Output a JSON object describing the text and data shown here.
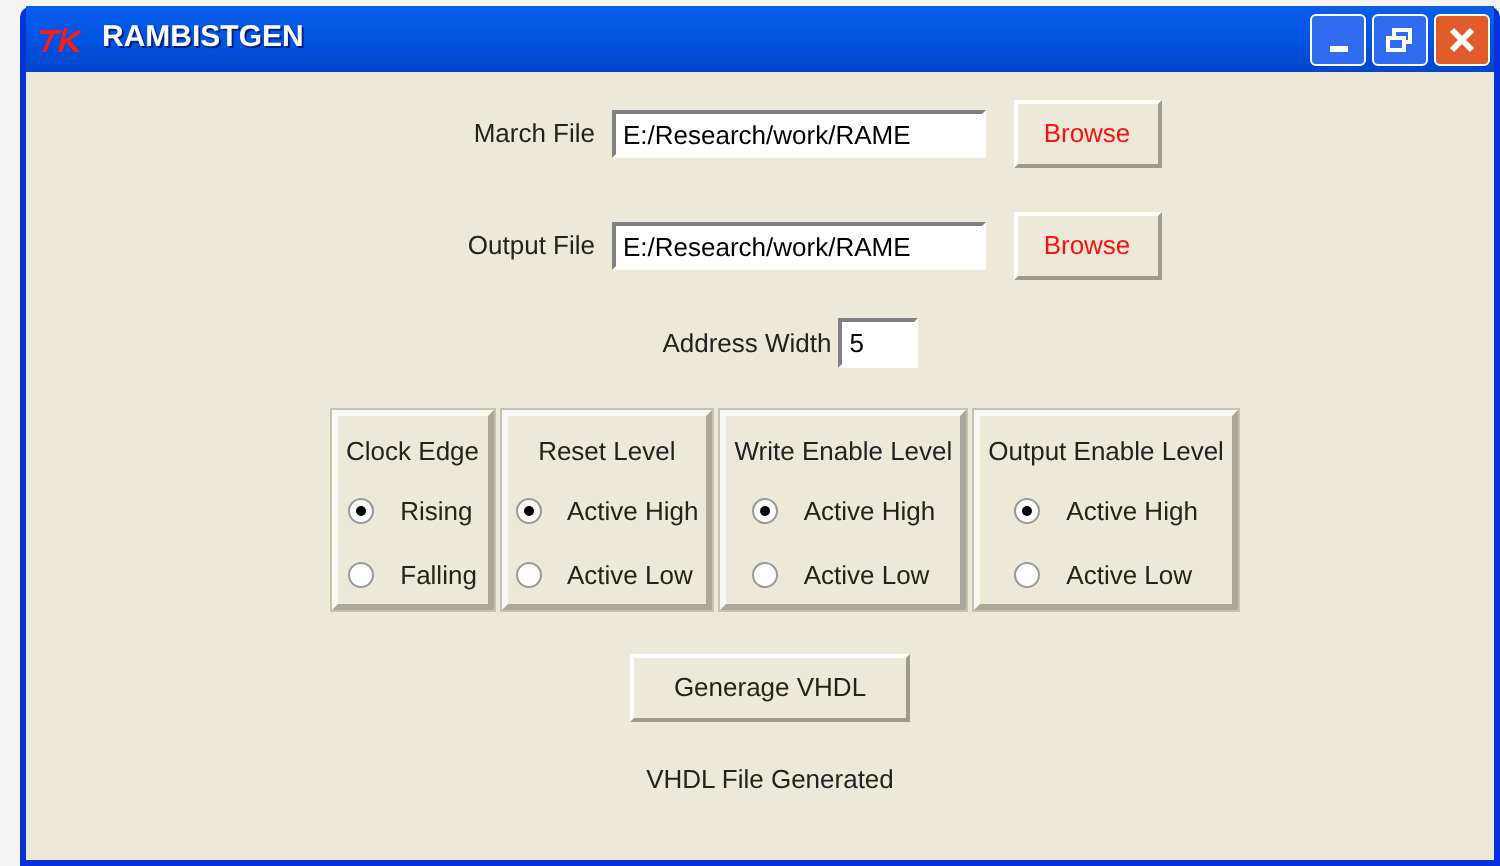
{
  "window": {
    "title": "RAMBISTGEN"
  },
  "files": [
    {
      "label": "March File",
      "value": "E:/Research/work/RAME",
      "button": "Browse"
    },
    {
      "label": "Output File",
      "value": "E:/Research/work/RAME",
      "button": "Browse"
    }
  ],
  "address_width": {
    "label": "Address Width",
    "value": "5"
  },
  "groups": [
    {
      "title": "Clock Edge",
      "options": [
        {
          "label": "Rising",
          "selected": true
        },
        {
          "label": "Falling",
          "selected": false
        }
      ]
    },
    {
      "title": "Reset Level",
      "options": [
        {
          "label": "Active High",
          "selected": true
        },
        {
          "label": "Active Low",
          "selected": false
        }
      ]
    },
    {
      "title": "Write Enable Level",
      "options": [
        {
          "label": "Active High",
          "selected": true
        },
        {
          "label": "Active Low",
          "selected": false
        }
      ]
    },
    {
      "title": "Output Enable Level",
      "options": [
        {
          "label": "Active High",
          "selected": true
        },
        {
          "label": "Active Low",
          "selected": false
        }
      ]
    }
  ],
  "generate_button": "Generage VHDL",
  "status": "VHDL File Generated"
}
